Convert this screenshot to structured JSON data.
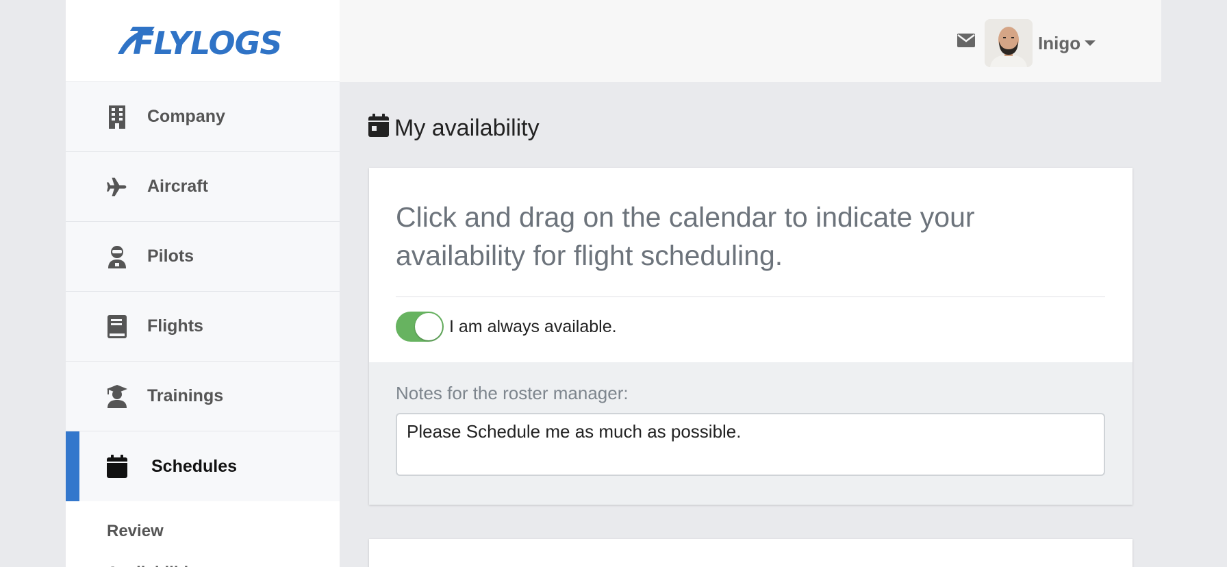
{
  "brand": {
    "logo_text": "FLYLOGS",
    "color": "#2f73c6"
  },
  "sidebar": {
    "items": [
      {
        "label": "Company",
        "icon": "building-icon"
      },
      {
        "label": "Aircraft",
        "icon": "plane-icon"
      },
      {
        "label": "Pilots",
        "icon": "pilot-icon"
      },
      {
        "label": "Flights",
        "icon": "logbook-icon"
      },
      {
        "label": "Trainings",
        "icon": "graduate-icon"
      },
      {
        "label": "Schedules",
        "icon": "calendar-icon",
        "active": true
      }
    ],
    "subitems": [
      {
        "label": "Review"
      },
      {
        "label": "Availabilities"
      }
    ],
    "active_color": "#3377cc"
  },
  "header": {
    "mail_icon": "envelope-icon",
    "user_name": "Inigo"
  },
  "page": {
    "title": "My availability",
    "title_icon": "calendar-icon",
    "lead_text": "Click and drag on the calendar to indicate your availability for flight scheduling.",
    "toggle": {
      "label": "I am always available.",
      "checked": true,
      "color": "#67b360"
    },
    "notes_label": "Notes for the roster manager:",
    "notes_value": "Please Schedule me as much as possible."
  }
}
